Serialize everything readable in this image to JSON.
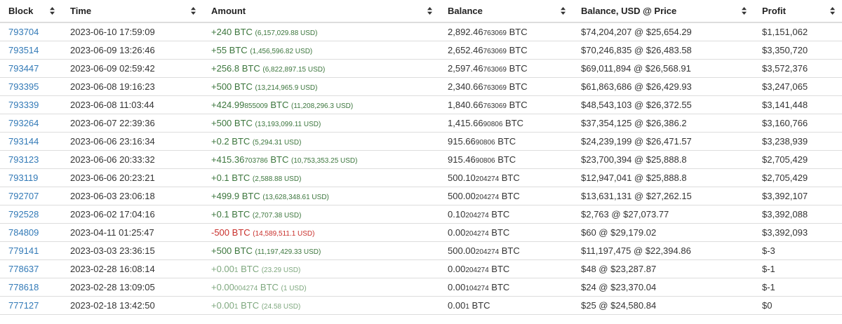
{
  "colors": {
    "link": "#337ab7",
    "positive": "#3c763d",
    "negative": "#c9302c",
    "dust": "#7fa87f",
    "border": "#dddddd"
  },
  "icons": {
    "sort": "sort-both-icon"
  },
  "columns": [
    "Block",
    "Time",
    "Amount",
    "Balance",
    "Balance, USD @ Price",
    "Profit"
  ],
  "rows": [
    {
      "block": "793704",
      "time": "2023-06-10 17:59:09",
      "amount": {
        "sign": "pos",
        "main": "+240",
        "frac": "",
        "unit": " BTC",
        "usd": "(6,157,029.88 USD)"
      },
      "balance": {
        "main": "2,892.46",
        "frac": "763069",
        "unit": " BTC"
      },
      "balance_usd": "$74,204,207 @ $25,654.29",
      "profit": "$1,151,062"
    },
    {
      "block": "793514",
      "time": "2023-06-09 13:26:46",
      "amount": {
        "sign": "pos",
        "main": "+55",
        "frac": "",
        "unit": " BTC",
        "usd": "(1,456,596.82 USD)"
      },
      "balance": {
        "main": "2,652.46",
        "frac": "763069",
        "unit": " BTC"
      },
      "balance_usd": "$70,246,835 @ $26,483.58",
      "profit": "$3,350,720"
    },
    {
      "block": "793447",
      "time": "2023-06-09 02:59:42",
      "amount": {
        "sign": "pos",
        "main": "+256.8",
        "frac": "",
        "unit": " BTC",
        "usd": "(6,822,897.15 USD)"
      },
      "balance": {
        "main": "2,597.46",
        "frac": "763069",
        "unit": " BTC"
      },
      "balance_usd": "$69,011,894 @ $26,568.91",
      "profit": "$3,572,376"
    },
    {
      "block": "793395",
      "time": "2023-06-08 19:16:23",
      "amount": {
        "sign": "pos",
        "main": "+500",
        "frac": "",
        "unit": " BTC",
        "usd": "(13,214,965.9 USD)"
      },
      "balance": {
        "main": "2,340.66",
        "frac": "763069",
        "unit": " BTC"
      },
      "balance_usd": "$61,863,686 @ $26,429.93",
      "profit": "$3,247,065"
    },
    {
      "block": "793339",
      "time": "2023-06-08 11:03:44",
      "amount": {
        "sign": "pos",
        "main": "+424.99",
        "frac": "855009",
        "unit": " BTC",
        "usd": "(11,208,296.3 USD)"
      },
      "balance": {
        "main": "1,840.66",
        "frac": "763069",
        "unit": " BTC"
      },
      "balance_usd": "$48,543,103 @ $26,372.55",
      "profit": "$3,141,448"
    },
    {
      "block": "793264",
      "time": "2023-06-07 22:39:36",
      "amount": {
        "sign": "pos",
        "main": "+500",
        "frac": "",
        "unit": " BTC",
        "usd": "(13,193,099.11 USD)"
      },
      "balance": {
        "main": "1,415.66",
        "frac": "90806",
        "unit": " BTC"
      },
      "balance_usd": "$37,354,125 @ $26,386.2",
      "profit": "$3,160,766"
    },
    {
      "block": "793144",
      "time": "2023-06-06 23:16:34",
      "amount": {
        "sign": "pos",
        "main": "+0.2",
        "frac": "",
        "unit": " BTC",
        "usd": "(5,294.31 USD)"
      },
      "balance": {
        "main": "915.66",
        "frac": "90806",
        "unit": " BTC"
      },
      "balance_usd": "$24,239,199 @ $26,471.57",
      "profit": "$3,238,939"
    },
    {
      "block": "793123",
      "time": "2023-06-06 20:33:32",
      "amount": {
        "sign": "pos",
        "main": "+415.36",
        "frac": "703786",
        "unit": " BTC",
        "usd": "(10,753,353.25 USD)"
      },
      "balance": {
        "main": "915.46",
        "frac": "90806",
        "unit": " BTC"
      },
      "balance_usd": "$23,700,394 @ $25,888.8",
      "profit": "$2,705,429"
    },
    {
      "block": "793119",
      "time": "2023-06-06 20:23:21",
      "amount": {
        "sign": "pos",
        "main": "+0.1",
        "frac": "",
        "unit": " BTC",
        "usd": "(2,588.88 USD)"
      },
      "balance": {
        "main": "500.10",
        "frac": "204274",
        "unit": " BTC"
      },
      "balance_usd": "$12,947,041 @ $25,888.8",
      "profit": "$2,705,429"
    },
    {
      "block": "792707",
      "time": "2023-06-03 23:06:18",
      "amount": {
        "sign": "pos",
        "main": "+499.9",
        "frac": "",
        "unit": " BTC",
        "usd": "(13,628,348.61 USD)"
      },
      "balance": {
        "main": "500.00",
        "frac": "204274",
        "unit": " BTC"
      },
      "balance_usd": "$13,631,131 @ $27,262.15",
      "profit": "$3,392,107"
    },
    {
      "block": "792528",
      "time": "2023-06-02 17:04:16",
      "amount": {
        "sign": "pos",
        "main": "+0.1",
        "frac": "",
        "unit": " BTC",
        "usd": "(2,707.38 USD)"
      },
      "balance": {
        "main": "0.10",
        "frac": "204274",
        "unit": " BTC"
      },
      "balance_usd": "$2,763 @ $27,073.77",
      "profit": "$3,392,088"
    },
    {
      "block": "784809",
      "time": "2023-04-11 01:25:47",
      "amount": {
        "sign": "neg",
        "main": "-500",
        "frac": "",
        "unit": " BTC",
        "usd": "(14,589,511.1 USD)"
      },
      "balance": {
        "main": "0.00",
        "frac": "204274",
        "unit": " BTC"
      },
      "balance_usd": "$60 @ $29,179.02",
      "profit": "$3,392,093"
    },
    {
      "block": "779141",
      "time": "2023-03-03 23:36:15",
      "amount": {
        "sign": "pos",
        "main": "+500",
        "frac": "",
        "unit": " BTC",
        "usd": "(11,197,429.33 USD)"
      },
      "balance": {
        "main": "500.00",
        "frac": "204274",
        "unit": " BTC"
      },
      "balance_usd": "$11,197,475 @ $22,394.86",
      "profit": "$-3"
    },
    {
      "block": "778637",
      "time": "2023-02-28 16:08:14",
      "amount": {
        "sign": "dim",
        "main": "+0.00",
        "frac": "1",
        "unit": " BTC",
        "usd": "(23.29 USD)"
      },
      "balance": {
        "main": "0.00",
        "frac": "204274",
        "unit": " BTC"
      },
      "balance_usd": "$48 @ $23,287.87",
      "profit": "$-1"
    },
    {
      "block": "778618",
      "time": "2023-02-28 13:09:05",
      "amount": {
        "sign": "dim",
        "main": "+0.00",
        "frac": "004274",
        "unit": " BTC",
        "usd": "(1 USD)"
      },
      "balance": {
        "main": "0.00",
        "frac": "104274",
        "unit": " BTC"
      },
      "balance_usd": "$24 @ $23,370.04",
      "profit": "$-1"
    },
    {
      "block": "777127",
      "time": "2023-02-18 13:42:50",
      "amount": {
        "sign": "dim",
        "main": "+0.00",
        "frac": "1",
        "unit": " BTC",
        "usd": "(24.58 USD)"
      },
      "balance": {
        "main": "0.00",
        "frac": "1",
        "unit": " BTC"
      },
      "balance_usd": "$25 @ $24,580.84",
      "profit": "$0"
    }
  ]
}
